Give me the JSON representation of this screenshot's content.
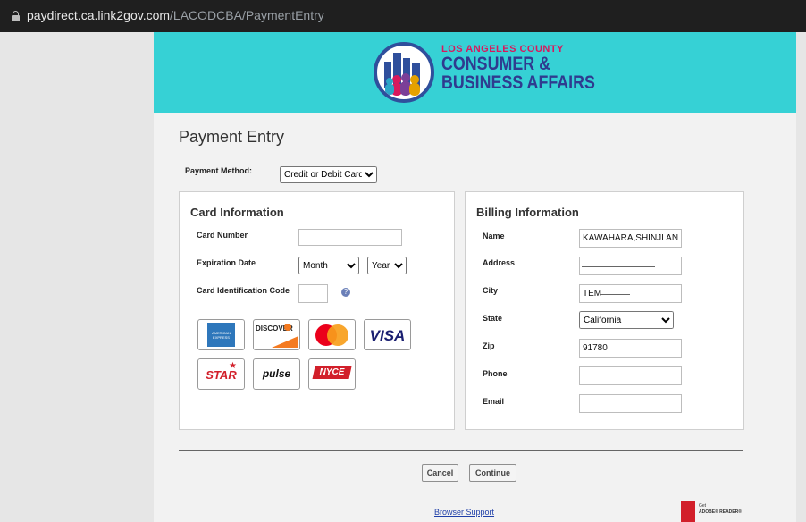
{
  "browser": {
    "url_host": "paydirect.ca.link2gov.com",
    "url_path": "/LACODCBA/PaymentEntry"
  },
  "banner": {
    "small_text": "LOS ANGELES COUNTY",
    "line1": "CONSUMER &",
    "line2": "BUSINESS AFFAIRS",
    "colors": {
      "background": "#36d1d5",
      "navy": "#2f3b8f",
      "magenta": "#d8195d"
    }
  },
  "page": {
    "title": "Payment Entry",
    "payment_method_label": "Payment Method:",
    "payment_method_value": "Credit or Debit Card"
  },
  "card_info": {
    "title": "Card Information",
    "card_number_label": "Card Number",
    "card_number_value": "",
    "expiration_label": "Expiration Date",
    "month_value": "Month",
    "year_value": "Year",
    "cid_label": "Card Identification Code",
    "cid_value": "",
    "card_brands": [
      {
        "icon": "amex-card-icon",
        "text": "AMERICAN EXPRESS"
      },
      {
        "icon": "discover-card-icon",
        "text": "DISCOVER"
      },
      {
        "icon": "mastercard-card-icon",
        "text": ""
      },
      {
        "icon": "visa-card-icon",
        "text": "VISA"
      },
      {
        "icon": "star-card-icon",
        "text": "STAR"
      },
      {
        "icon": "pulse-card-icon",
        "text": "pulse"
      },
      {
        "icon": "nyce-card-icon",
        "text": "NYCE"
      }
    ]
  },
  "billing": {
    "title": "Billing Information",
    "name_label": "Name",
    "name_value": "KAWAHARA,SHINJI AND",
    "address_label": "Address",
    "address_value": "",
    "city_label": "City",
    "city_value": "TEM",
    "state_label": "State",
    "state_value": "California",
    "zip_label": "Zip",
    "zip_value": "91780",
    "phone_label": "Phone",
    "phone_value": "",
    "email_label": "Email",
    "email_value": ""
  },
  "actions": {
    "cancel_label": "Cancel",
    "continue_label": "Continue"
  },
  "footer": {
    "browser_support_label": "Browser Support",
    "adobe_small": "Get",
    "adobe_text": "ADOBE® READER®"
  }
}
